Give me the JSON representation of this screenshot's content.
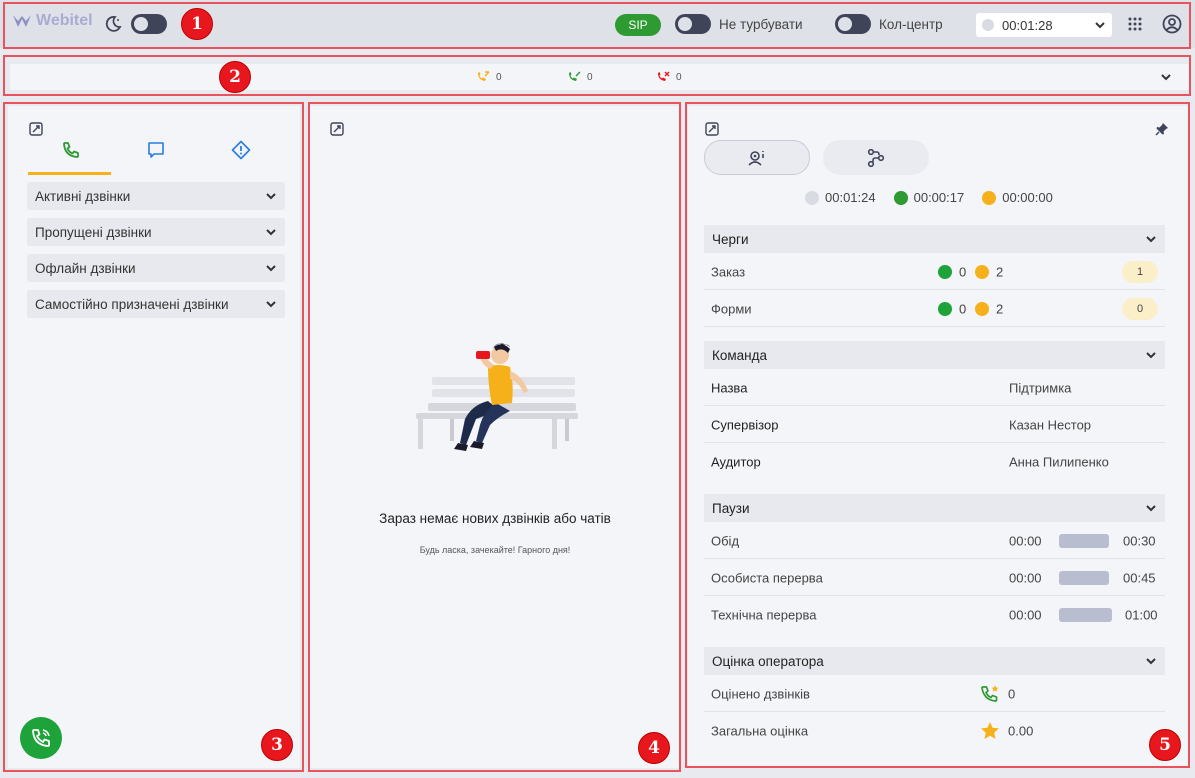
{
  "topbar": {
    "brand": "Webitel",
    "sip_label": "SIP",
    "dnd_label": "Не турбувати",
    "callcenter_label": "Кол-центр",
    "status_timer": "00:01:28"
  },
  "strip": {
    "incoming_count": "0",
    "answered_count": "0",
    "missed_count": "0"
  },
  "left_panel": {
    "tabs": [
      "calls",
      "chats",
      "alerts"
    ],
    "sections": [
      {
        "label": "Активні дзвінки"
      },
      {
        "label": "Пропущені дзвінки"
      },
      {
        "label": "Офлайн дзвінки"
      },
      {
        "label": "Самостійно призначені дзвінки"
      }
    ]
  },
  "center_panel": {
    "empty_title": "Зараз немає нових дзвінків або чатів",
    "empty_subtitle": "Будь ласка, зачекайте! Гарного дня!"
  },
  "right_panel": {
    "timers": [
      {
        "value": "00:01:24",
        "color": "#d9dbe3"
      },
      {
        "value": "00:00:17",
        "color": "#2e9a32"
      },
      {
        "value": "00:00:00",
        "color": "#f6b11a"
      }
    ],
    "queues": {
      "title": "Черги",
      "rows": [
        {
          "name": "Заказ",
          "green": "0",
          "yellow": "2",
          "badge": "1"
        },
        {
          "name": "Форми",
          "green": "0",
          "yellow": "2",
          "badge": "0"
        }
      ]
    },
    "team": {
      "title": "Команда",
      "rows": [
        {
          "label": "Назва",
          "value": "Підтримка"
        },
        {
          "label": "Супервізор",
          "value": "Казан Нестор"
        },
        {
          "label": "Аудитор",
          "value": "Анна Пилипенко"
        }
      ]
    },
    "pauses": {
      "title": "Паузи",
      "rows": [
        {
          "name": "Обід",
          "start": "00:00",
          "end": "00:30"
        },
        {
          "name": "Особиста перерва",
          "start": "00:00",
          "end": "00:45"
        },
        {
          "name": "Технічна перерва",
          "start": "00:00",
          "end": "01:00"
        }
      ]
    },
    "rating": {
      "title": "Оцінка оператора",
      "rows": [
        {
          "label": "Оцінено дзвінків",
          "value": "0"
        },
        {
          "label": "Загальна оцінка",
          "value": "0.00"
        }
      ]
    }
  },
  "markers": [
    "1",
    "2",
    "3",
    "4",
    "5"
  ]
}
